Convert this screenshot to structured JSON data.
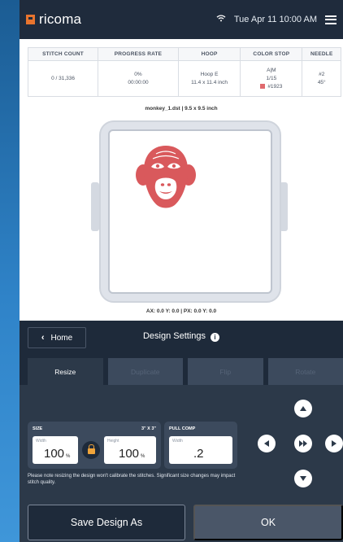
{
  "header": {
    "brand": "ricoma",
    "datetime": "Tue Apr 11  10:00 AM",
    "icons": [
      "wifi-icon",
      "menu-icon"
    ]
  },
  "stats": {
    "columns": [
      "STITCH COUNT",
      "PROGRESS RATE",
      "HOOP",
      "COLOR STOP",
      "NEEDLE"
    ],
    "stitch_count": "0 / 31,336",
    "progress_percent": "0%",
    "progress_time": "00:00:00",
    "hoop_name": "Hoop E",
    "hoop_size": "11.4 x 11.4 inch",
    "color_stop_mode": "A|M",
    "color_stop_count": "1/15",
    "color_code": "#1923",
    "color_swatch": "#e06a6e",
    "needle_number": "#2",
    "needle_angle": "45°"
  },
  "design": {
    "file_info": "monkey_1.dst  |  9.5 x 9.5 inch",
    "coords": "AX: 0.0  Y: 0.0  |  PX: 0.0  Y: 0.0",
    "motif_color": "#d9595c"
  },
  "nav": {
    "home_label": "Home",
    "title": "Design Settings"
  },
  "tabs": [
    "Resize",
    "Duplicate",
    "Flip",
    "Rotate"
  ],
  "size": {
    "label": "SIZE",
    "dimension": "3\" X 3\"",
    "width_label": "Width",
    "width_value": "100",
    "height_label": "Height",
    "height_value": "100",
    "unit": "%"
  },
  "pull_comp": {
    "label": "PULL COMP",
    "width_label": "Width",
    "value": ".2"
  },
  "note": "Please note resizing the design won't calibrate the stitches. Significant size changes may impact stitch quality.",
  "actions": {
    "save_label": "Save Design As",
    "ok_label": "OK"
  }
}
